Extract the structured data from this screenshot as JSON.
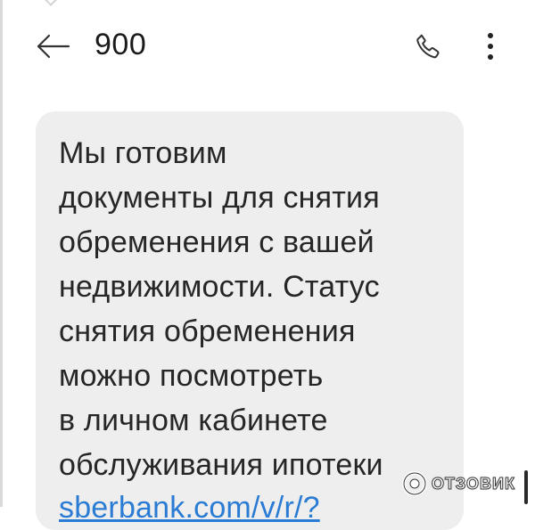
{
  "header": {
    "title": "900"
  },
  "message": {
    "text": "Мы готовим\nдокументы для снятия\nобременения с вашей\nнедвижимости. Статус\nснятия обременения\nможно посмотреть\nв личном кабинете\nобслуживания ипотеки",
    "link": "sberbank.com/v/r/?"
  },
  "watermark": {
    "text": "ОТЗОВИК"
  },
  "colors": {
    "link": "#2a7bd4",
    "bubble": "#eeeeee",
    "text": "#262626"
  },
  "icons": {
    "back": "arrow-left-icon",
    "call": "phone-icon",
    "menu": "more-vertical-icon"
  }
}
